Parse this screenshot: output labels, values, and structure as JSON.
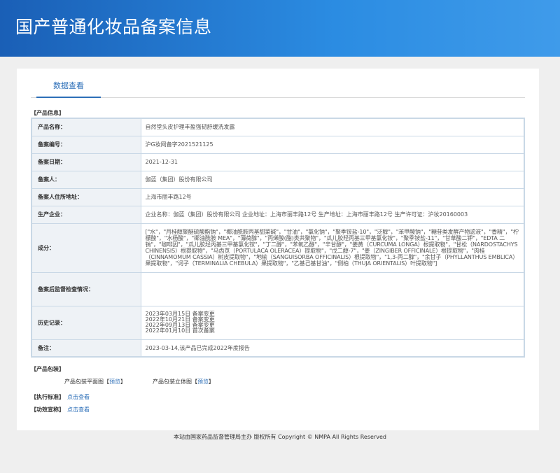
{
  "header": {
    "title": "国产普通化妆品备案信息"
  },
  "tab": {
    "label": "数据查看"
  },
  "sections": {
    "product_info": "【产品信息】",
    "product_package": "【产品包装】",
    "exec_standard": "【执行标准】",
    "efficacy_claim": "【功效宣称】"
  },
  "product": {
    "rows": [
      {
        "key": "产品名称：",
        "value": "自然堂头皮护理丰盈强韧舒缓洗发露"
      },
      {
        "key": "备案编号：",
        "value": "沪G妆网备字2021521125"
      },
      {
        "key": "备案日期：",
        "value": "2021-12-31"
      },
      {
        "key": "备案人：",
        "value": "伽蓝（集团）股份有限公司"
      },
      {
        "key": "备案人住所地址：",
        "value": "上海市丽丰路12号"
      },
      {
        "key": "生产企业：",
        "value": "企业名称：伽蓝（集团）股份有限公司 企业地址：上海市丽丰路12号 生产地址：上海市丽丰路12号 生产许可证：沪妆20160003"
      },
      {
        "key": "成分：",
        "value": "[\"水\"，\"月桂醇聚醚硫酸酯钠\"，\"椰油酰胺丙基甜菜碱\"，\"甘油\"，\"氯化钠\"，\"聚季铵盐-10\"，\"泛醇\"，\"苯甲酸钠\"，\"糖苷类发酵产物滤液\"，\"香精\"，\"柠檬酸\"，\"水杨酸\"，\"椰油酰胺 MEA\"，\"薄荷醇\"，\"丙烯酸(酯)类共聚物\"，\"瓜儿胶羟丙基三甲基氯化铵\"，\"聚季铵盐-11\"，\"甘草酸二钾\"，\"EDTA 二钠\"，\"咖啡因\"，\"瓜儿胶羟丙基三甲基氯化铵\"，\"丁二醇\"，\"苯氧乙醇\"，\"辛甘醇\"，\"姜黄（CURCUMA LONGA）根提取物\"，\"甘松（NARDOSTACHYS CHINENSIS）根提取物\"，\"马齿苋（PORTULACA OLERACEA）提取物\"，\"戊二醇-7\"，\"姜（ZINGIBER OFFICINALE）根提取物\"，\"肉桂（CINNAMOMUM CASSIA）树皮提取物\"，\"地榆（SANGUISORBA OFFICINALIS）根提取物\"，\"1,3-丙二醇\"，\"余甘子（PHYLLANTHUS EMBLICA）果提取物\"，\"诃子（TERMINALIA CHEBULA）果提取物\"，\"乙基己基甘油\"，\"侧柏（THUJA ORIENTALIS）叶提取物\"]"
      },
      {
        "key": "备案后监督检查情况：",
        "value": ""
      },
      {
        "key": "历史记录：",
        "value": ""
      },
      {
        "key": "备注：",
        "value": "2023-03-14,该产品已完成2022年度报告"
      }
    ],
    "history": [
      "2023年03月15日 备案变更",
      "2022年10月21日 备案变更",
      "2022年09月13日 备案变更",
      "2022年01月10日 首次备案"
    ]
  },
  "package": {
    "flat_label": "产品包装平面图",
    "stereo_label": "产品包装立体图",
    "preview_text": "预览",
    "bracket_open": "【",
    "bracket_close": "】"
  },
  "links": {
    "view_text": "点击查看"
  },
  "footer": {
    "text": "本站由国家药品监督管理局主办 版权所有 Copyright © NMPA All Rights Reserved"
  },
  "colors": {
    "banner": "#2b8ce2",
    "link": "#2d6fb8",
    "key_bg": "#eef2f6",
    "border": "#c9d8e6"
  }
}
